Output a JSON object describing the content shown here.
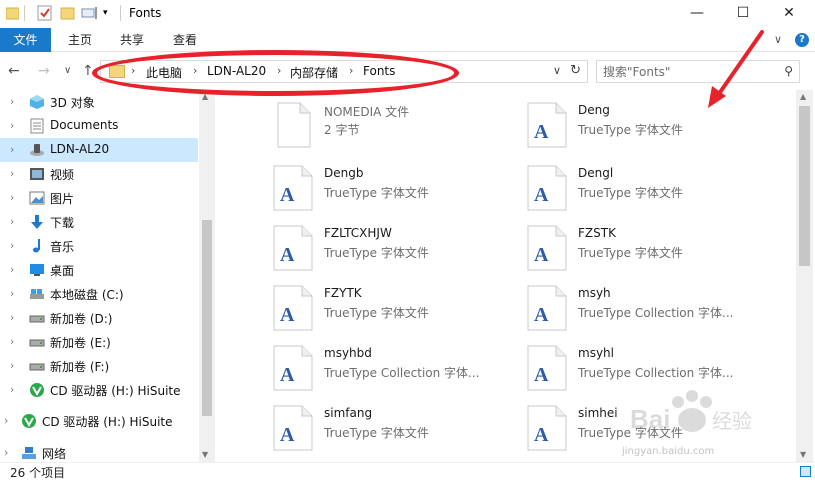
{
  "window": {
    "title": "Fonts",
    "minimize_glyph": "—",
    "maximize_glyph": "☐",
    "close_glyph": "✕"
  },
  "ribbon": {
    "tabs": [
      "文件",
      "主页",
      "共享",
      "查看"
    ],
    "expand_glyph": "∨",
    "help_glyph": "?"
  },
  "nav": {
    "back_glyph": "←",
    "forward_glyph": "→",
    "recent_glyph": "∨",
    "up_glyph": "↑",
    "breadcrumb": [
      "此电脑",
      "LDN-AL20",
      "内部存储",
      "Fonts"
    ],
    "separator_glyph": "›",
    "refresh_glyph": "↻",
    "search_placeholder": "搜索\"Fonts\"",
    "search_glyph": "⚲"
  },
  "sidebar": {
    "items": [
      {
        "label": "3D 对象",
        "icon": "cube-3d-icon"
      },
      {
        "label": "Documents",
        "icon": "document-folder-icon"
      },
      {
        "label": "LDN-AL20",
        "icon": "phone-device-icon",
        "selected": true
      },
      {
        "label": "视频",
        "icon": "video-folder-icon"
      },
      {
        "label": "图片",
        "icon": "picture-folder-icon"
      },
      {
        "label": "下载",
        "icon": "download-arrow-icon"
      },
      {
        "label": "音乐",
        "icon": "music-note-icon"
      },
      {
        "label": "桌面",
        "icon": "desktop-icon"
      },
      {
        "label": "本地磁盘 (C:)",
        "icon": "local-disk-icon"
      },
      {
        "label": "新加卷 (D:)",
        "icon": "drive-icon"
      },
      {
        "label": "新加卷 (E:)",
        "icon": "drive-icon"
      },
      {
        "label": "新加卷 (F:)",
        "icon": "drive-icon"
      },
      {
        "label": "CD 驱动器 (H:) HiSuite",
        "icon": "hisuite-cd-icon"
      },
      {
        "label": "CD 驱动器 (H:) HiSuite",
        "icon": "hisuite-cd-icon"
      },
      {
        "label": "网络",
        "icon": "network-icon"
      }
    ]
  },
  "files": [
    {
      "name": "NOMEDIA 文件",
      "type": "2 字节",
      "font_icon": false
    },
    {
      "name": "Deng",
      "type": "TrueType 字体文件",
      "font_icon": true
    },
    {
      "name": "Dengb",
      "type": "TrueType 字体文件",
      "font_icon": true
    },
    {
      "name": "Dengl",
      "type": "TrueType 字体文件",
      "font_icon": true
    },
    {
      "name": "FZLTCXHJW",
      "type": "TrueType 字体文件",
      "font_icon": true
    },
    {
      "name": "FZSTK",
      "type": "TrueType 字体文件",
      "font_icon": true
    },
    {
      "name": "FZYTK",
      "type": "TrueType 字体文件",
      "font_icon": true
    },
    {
      "name": "msyh",
      "type": "TrueType Collection 字体...",
      "font_icon": true
    },
    {
      "name": "msyhbd",
      "type": "TrueType Collection 字体...",
      "font_icon": true
    },
    {
      "name": "msyhl",
      "type": "TrueType Collection 字体...",
      "font_icon": true
    },
    {
      "name": "simfang",
      "type": "TrueType 字体文件",
      "font_icon": true
    },
    {
      "name": "simhei",
      "type": "TrueType 字体文件",
      "font_icon": true
    }
  ],
  "status": {
    "item_count": "26 个项目"
  },
  "watermark": {
    "text": "Baidu 经验",
    "url": "jingyan.baidu.com"
  },
  "colors": {
    "accent": "#1979ca",
    "selection": "#cce8ff",
    "annotation": "#e8222a"
  }
}
